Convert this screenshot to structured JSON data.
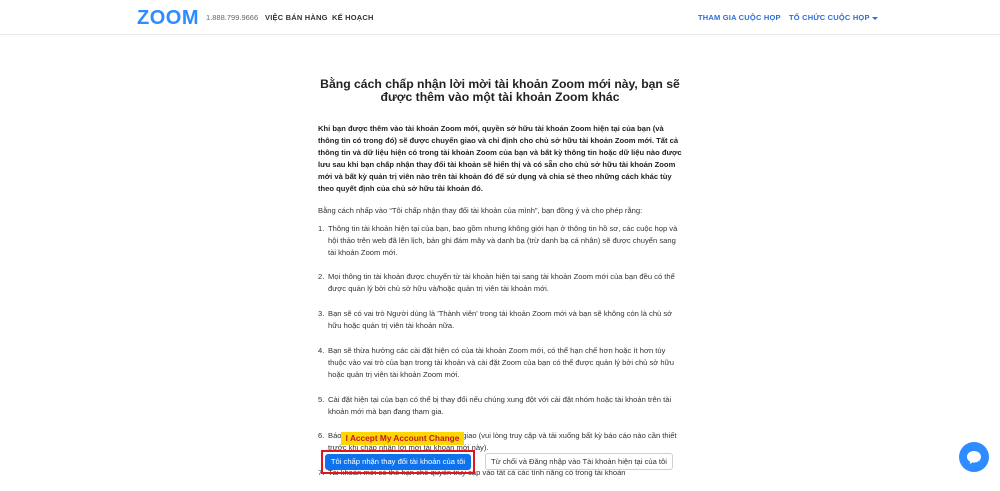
{
  "header": {
    "logo": "ZOOM",
    "phone": "1.888.799.9666",
    "sales": "VIỆC BÁN HÀNG",
    "plans": "KẾ HOẠCH",
    "join": "THAM GIA CUỘC HỌP",
    "host": "TỔ CHỨC CUỘC HỌP"
  },
  "main": {
    "title": "Bằng cách chấp nhận lời mời tài khoản Zoom mới này, bạn sẽ được thêm vào một tài khoản Zoom khác",
    "bold_paragraph": "Khi bạn được thêm vào tài khoản Zoom mới, quyền sở hữu tài khoản Zoom hiện tại của bạn (và thông tin có trong đó) sẽ được chuyển giao và chỉ định cho chủ sở hữu tài khoản Zoom mới. Tất cả thông tin và dữ liệu hiện có trong tài khoản Zoom của bạn và bất kỳ thông tin hoặc dữ liệu nào được lưu sau khi bạn chấp nhận thay đổi tài khoản sẽ hiển thị và có sẵn cho chủ sở hữu tài khoản Zoom mới và bất kỳ quản trị viên nào trên tài khoản đó để sử dụng và chia sẻ theo những cách khác tùy theo quyết định của chủ sở hữu tài khoản đó.",
    "intro": "Bằng cách nhấp vào “Tôi chấp nhận thay đổi tài khoản của mình”, bạn đồng ý và cho phép rằng:",
    "terms": [
      {
        "num": "1.",
        "text": "Thông tin tài khoản hiện tại của bạn, bao gồm nhưng không giới hạn ở thông tin hồ sơ, các cuộc họp và hội thảo trên web đã lên lịch, bản ghi đám mây và danh bạ (trừ danh bạ cá nhân) sẽ được chuyển sang tài khoản Zoom mới."
      },
      {
        "num": "2.",
        "text": "Mọi thông tin tài khoản được chuyển từ tài khoản hiện tại sang tài khoản Zoom mới của bạn đều có thể được quản lý bởi chủ sở hữu và/hoặc quản trị viên tài khoản mới."
      },
      {
        "num": "3.",
        "text": "Bạn sẽ có vai trò Người dùng là 'Thành viên' trong tài khoản Zoom mới và bạn sẽ không còn là chủ sở hữu hoặc quản trị viên tài khoản nữa."
      },
      {
        "num": "4.",
        "text": "Bạn sẽ thừa hưởng các cài đặt hiện có của tài khoản Zoom mới, có thể hạn chế hơn hoặc ít hơn tùy thuộc vào vai trò của bạn trong tài khoản và cài đặt Zoom của bạn có thể được quản lý bởi chủ sở hữu hoặc quản trị viên tài khoản Zoom mới."
      },
      {
        "num": "5.",
        "text": "Cài đặt hiện tại của bạn có thể bị thay đổi nếu chúng xung đột với cài đặt nhóm hoặc tài khoản trên tài khoản mới mà bạn đang tham gia."
      },
      {
        "num": "6.",
        "text": "Báo cáo lịch sử sẽ không được chuyển giao (vui lòng truy cập và tải xuống bất kỳ báo cáo nào cần thiết trước khi chấp nhận lời mời tài khoản mới này)."
      },
      {
        "num": "7.",
        "text": "Tài khoản mới có thể hạn chế quyền truy cập vào tất cả các tính năng có trong tài khoản"
      }
    ],
    "highlight": "I Accept My Account Change",
    "accept_button": "Tôi chấp nhận thay đổi tài khoản của tôi",
    "decline_button": "Từ chối và Đăng nhập vào Tài khoản hiện tại của tôi"
  },
  "colors": {
    "brand": "#2d8cff",
    "accept": "#0e72ed",
    "annotation_frame": "#e0161c",
    "highlight": "#ffd700"
  },
  "icons": {
    "chat": "chat-bubble-icon"
  }
}
